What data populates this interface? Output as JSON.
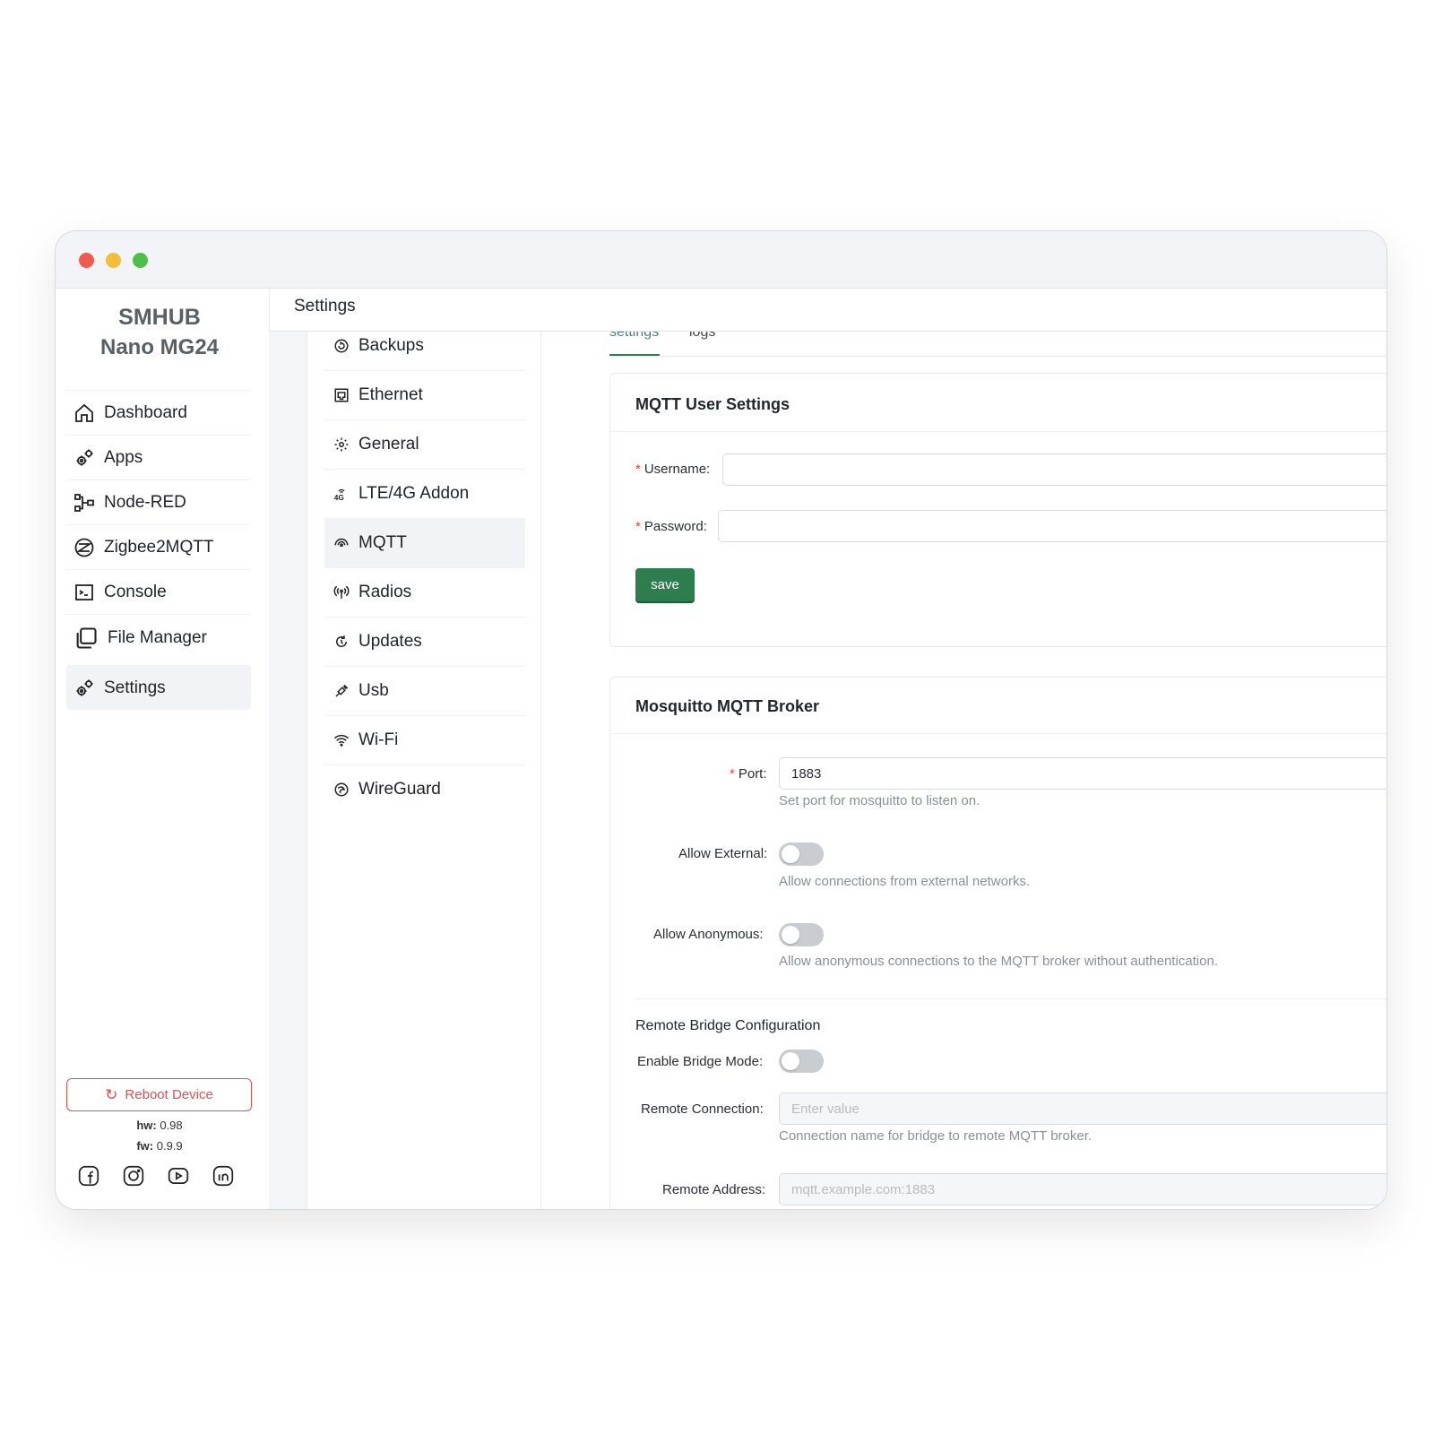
{
  "window": {
    "controls": [
      "close",
      "minimize",
      "maximize"
    ]
  },
  "brand": {
    "line1": "SMHUB",
    "line2": "Nano MG24"
  },
  "sidebar": {
    "items": [
      {
        "label": "Dashboard",
        "icon": "home-icon"
      },
      {
        "label": "Apps",
        "icon": "gears-icon"
      },
      {
        "label": "Node-RED",
        "icon": "flow-icon"
      },
      {
        "label": "Zigbee2MQTT",
        "icon": "zigbee-icon"
      },
      {
        "label": "Console",
        "icon": "terminal-icon"
      },
      {
        "label": "File Manager",
        "icon": "files-icon"
      },
      {
        "label": "Settings",
        "icon": "gears-icon"
      }
    ],
    "reboot_label": "Reboot Device",
    "hw_label": "hw:",
    "hw_value": "0.98",
    "fw_label": "fw:",
    "fw_value": "0.9.9",
    "social": [
      "facebook-icon",
      "instagram-icon",
      "youtube-icon",
      "linkedin-icon"
    ]
  },
  "header": {
    "title": "Settings"
  },
  "settings_menu": {
    "items": [
      {
        "label": "Backups",
        "icon": "backup-icon"
      },
      {
        "label": "Ethernet",
        "icon": "ethernet-icon"
      },
      {
        "label": "General",
        "icon": "gear-icon"
      },
      {
        "label": "LTE/4G Addon",
        "icon": "4g-icon"
      },
      {
        "label": "MQTT",
        "icon": "mqtt-icon"
      },
      {
        "label": "Radios",
        "icon": "radio-icon"
      },
      {
        "label": "Updates",
        "icon": "update-icon"
      },
      {
        "label": "Usb",
        "icon": "usb-icon"
      },
      {
        "label": "Wi-Fi",
        "icon": "wifi-icon"
      },
      {
        "label": "WireGuard",
        "icon": "wireguard-icon"
      }
    ],
    "active": "MQTT"
  },
  "tabs": {
    "settings": "settings",
    "logs": "logs"
  },
  "user_settings": {
    "title": "MQTT User Settings",
    "username_label": "Username",
    "username_value": "",
    "password_label": "Password",
    "password_value": "",
    "save_label": "save"
  },
  "broker": {
    "title": "Mosquitto MQTT Broker",
    "port_label": "Port",
    "port_value": "1883",
    "port_help": "Set port for mosquitto to listen on.",
    "external_label": "Allow External",
    "external_on": false,
    "external_help": "Allow connections from external networks.",
    "anon_label": "Allow Anonymous",
    "anon_on": false,
    "anon_help": "Allow anonymous connections to the MQTT broker without authentication.",
    "bridge_heading": "Remote Bridge Configuration",
    "bridge_label": "Enable Bridge Mode",
    "bridge_on": false,
    "remote_conn_label": "Remote Connection",
    "remote_conn_placeholder": "Enter value",
    "remote_conn_help": "Connection name for bridge to remote MQTT broker.",
    "remote_addr_label": "Remote Address",
    "remote_addr_placeholder": "mqtt.example.com:1883"
  },
  "colors": {
    "accent": "#2e7d4f",
    "danger": "#d9534f",
    "required": "#e2453c"
  }
}
